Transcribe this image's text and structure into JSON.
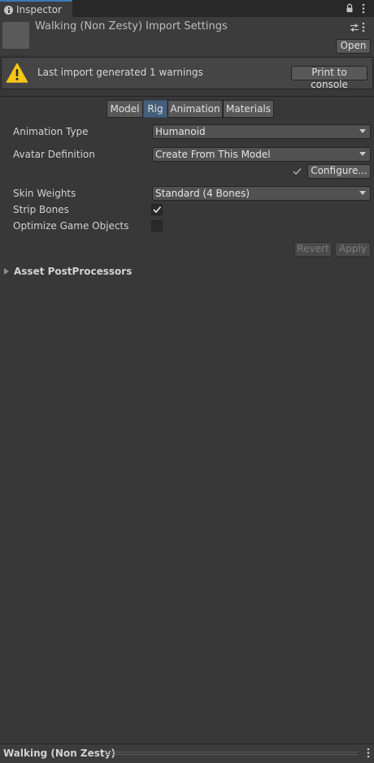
{
  "window": {
    "tab_label": "Inspector",
    "lock_icon": "lock-icon",
    "menu_icon": "kebab-menu-icon"
  },
  "header": {
    "title": "Walking (Non Zesty) Import Settings",
    "open_label": "Open",
    "settings_icon": "preset-settings-icon"
  },
  "warning": {
    "message": "Last import generated 1 warnings",
    "print_label": "Print to console",
    "icon": "warning-triangle-icon"
  },
  "tabs": [
    {
      "label": "Model",
      "active": false
    },
    {
      "label": "Rig",
      "active": true
    },
    {
      "label": "Animation",
      "active": false
    },
    {
      "label": "Materials",
      "active": false
    }
  ],
  "rig": {
    "animation_type": {
      "label": "Animation Type",
      "value": "Humanoid"
    },
    "avatar_definition": {
      "label": "Avatar Definition",
      "value": "Create From This Model"
    },
    "configure_label": "Configure...",
    "skin_weights": {
      "label": "Skin Weights",
      "value": "Standard (4 Bones)"
    },
    "strip_bones": {
      "label": "Strip Bones",
      "checked": true
    },
    "optimize_game_objects": {
      "label": "Optimize Game Objects",
      "checked": false
    }
  },
  "actions": {
    "revert_label": "Revert",
    "apply_label": "Apply"
  },
  "foldout": {
    "label": "Asset PostProcessors",
    "expanded": false
  },
  "footer": {
    "label": "Walking (Non Zesty)"
  },
  "colors": {
    "background": "#383838",
    "accent": "#3a79bb",
    "active_tab": "#46607c",
    "warning_yellow": "#f5c518"
  }
}
